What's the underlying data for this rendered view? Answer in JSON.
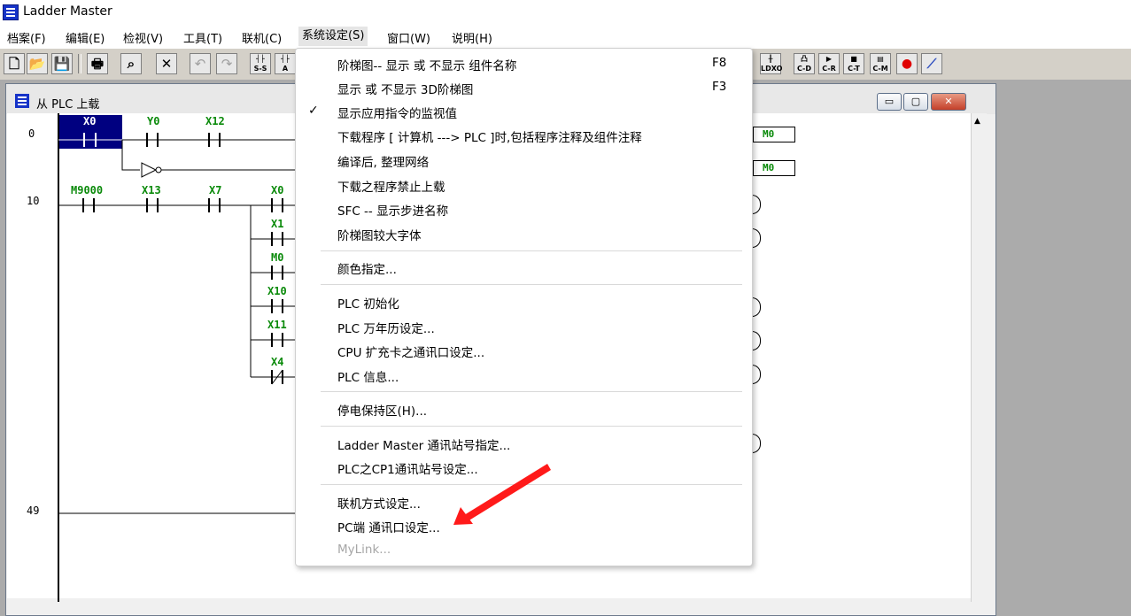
{
  "app": {
    "title": "Ladder Master"
  },
  "menubar": [
    {
      "label": "档案(F)"
    },
    {
      "label": "编辑(E)"
    },
    {
      "label": "检视(V)"
    },
    {
      "label": "工具(T)"
    },
    {
      "label": "联机(C)"
    },
    {
      "label": "系统设定(S)"
    },
    {
      "label": "窗口(W)"
    },
    {
      "label": "说明(H)"
    }
  ],
  "toolbar": {
    "icons": [
      "new-file-icon",
      "open-folder-icon",
      "save-icon",
      "print-icon",
      "find-icon",
      "delete-icon",
      "undo-icon",
      "redo-icon",
      "s-s-icon",
      "a-icon"
    ],
    "right_icons": [
      "ldxo-icon",
      "c-d-icon",
      "c-r-icon",
      "c-t-icon",
      "c-m-icon",
      "record-icon",
      "chart-icon"
    ],
    "labels": {
      "s_s": "S-S",
      "a": "A",
      "ldxo": "LDXO",
      "c_d": "C-D",
      "c_r": "C-R",
      "c_t": "C-T",
      "c_m": "C-M"
    }
  },
  "child_window": {
    "title": "从 PLC 上载",
    "buttons": {
      "minimize": "▭",
      "restore": "▢",
      "close": "✕"
    }
  },
  "ladder": {
    "steps": [
      "0",
      "10",
      "49"
    ],
    "contacts": [
      "X0",
      "Y0",
      "X12",
      "M9000",
      "X13",
      "X7",
      "X0",
      "X1",
      "M0",
      "X10",
      "X11",
      "X4"
    ],
    "outputs": [
      "M0",
      "M0"
    ]
  },
  "dropdown": {
    "items": [
      {
        "label": "阶梯图-- 显示 或 不显示 组件名称",
        "shortcut": "F8",
        "checked": false,
        "disabled": false
      },
      {
        "label": "显示 或 不显示 3D阶梯图",
        "shortcut": "F3",
        "checked": false,
        "disabled": false
      },
      {
        "label": "显示应用指令的监视值",
        "shortcut": "",
        "checked": true,
        "disabled": false
      },
      {
        "label": "下载程序 [ 计算机 ---> PLC ]时,包括程序注释及组件注释",
        "shortcut": "",
        "checked": false,
        "disabled": false
      },
      {
        "label": "编译后, 整理网络",
        "shortcut": "",
        "checked": false,
        "disabled": false
      },
      {
        "label": "下载之程序禁止上载",
        "shortcut": "",
        "checked": false,
        "disabled": false
      },
      {
        "label": "SFC -- 显示步进名称",
        "shortcut": "",
        "checked": false,
        "disabled": false
      },
      {
        "label": "阶梯图较大字体",
        "shortcut": "",
        "checked": false,
        "disabled": false
      },
      {
        "label": "颜色指定...",
        "shortcut": "",
        "checked": false,
        "disabled": false
      },
      {
        "label": "PLC 初始化",
        "shortcut": "",
        "checked": false,
        "disabled": false
      },
      {
        "label": "PLC 万年历设定...",
        "shortcut": "",
        "checked": false,
        "disabled": false
      },
      {
        "label": "CPU 扩充卡之通讯口设定...",
        "shortcut": "",
        "checked": false,
        "disabled": false
      },
      {
        "label": "PLC 信息...",
        "shortcut": "",
        "checked": false,
        "disabled": false
      },
      {
        "label": "停电保持区(H)...",
        "shortcut": "",
        "checked": false,
        "disabled": false
      },
      {
        "label": "Ladder Master 通讯站号指定...",
        "shortcut": "",
        "checked": false,
        "disabled": false
      },
      {
        "label": "PLC之CP1通讯站号设定...",
        "shortcut": "",
        "checked": false,
        "disabled": false
      },
      {
        "label": "联机方式设定...",
        "shortcut": "",
        "checked": false,
        "disabled": false
      },
      {
        "label": "PC端 通讯口设定...",
        "shortcut": "",
        "checked": false,
        "disabled": false
      },
      {
        "label": "MyLink...",
        "shortcut": "",
        "checked": false,
        "disabled": true
      }
    ],
    "check_glyph": "✓"
  },
  "annotation": {
    "arrow_color": "#ff1a1a",
    "arrow_target": "PC端 通讯口设定..."
  },
  "colors": {
    "accent_selection": "#000080",
    "contact_text": "#0a8a0a"
  }
}
